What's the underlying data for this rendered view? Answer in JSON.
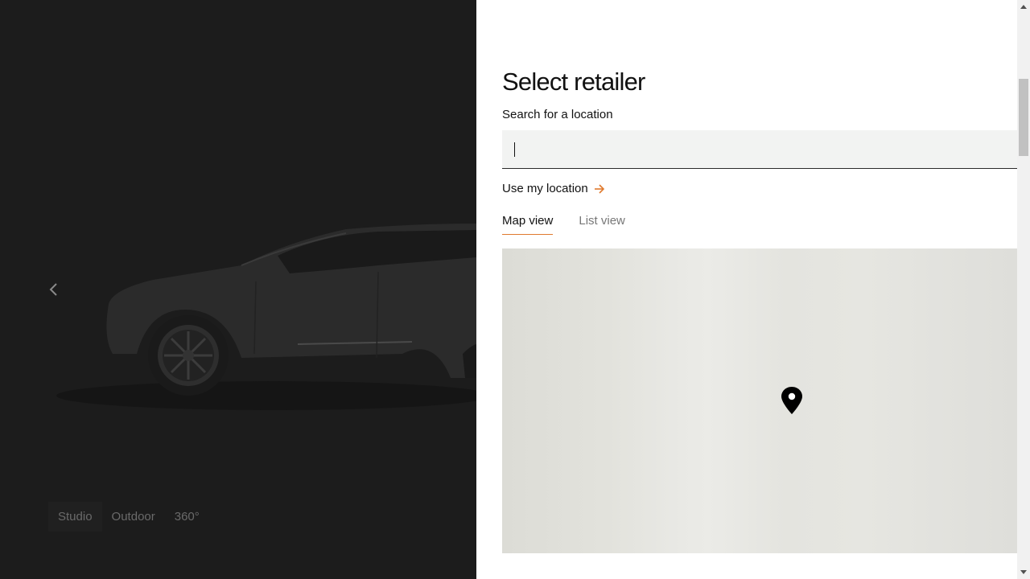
{
  "gallery": {
    "views": [
      {
        "label": "Studio"
      },
      {
        "label": "Outdoor"
      },
      {
        "label": "360°"
      }
    ]
  },
  "panel": {
    "title": "Select retailer",
    "search": {
      "label": "Search for a location",
      "value": "",
      "placeholder": ""
    },
    "use_location_label": "Use my location",
    "tabs": [
      {
        "label": "Map view",
        "active": true
      },
      {
        "label": "List view",
        "active": false
      }
    ]
  },
  "colors": {
    "accent": "#e07a2e",
    "backdrop": "#1c1c1c",
    "map_bg": "#e6e6e1"
  },
  "icons": {
    "prev": "chevron-left-icon",
    "use_location": "arrow-right-icon",
    "map_pin": "map-pin-icon"
  }
}
